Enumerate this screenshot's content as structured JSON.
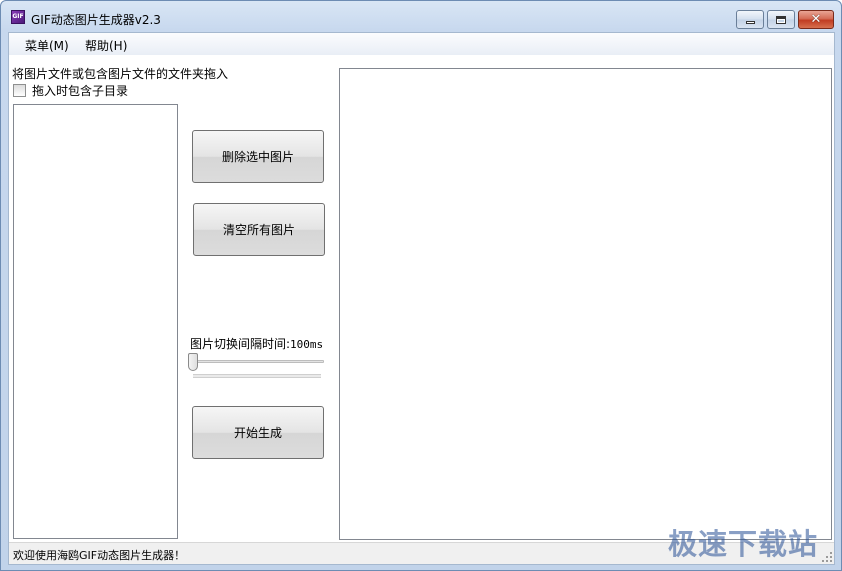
{
  "window": {
    "title": "GIF动态图片生成器v2.3",
    "icon_text": "GIF"
  },
  "menu": {
    "items": [
      {
        "label": "菜单(M)"
      },
      {
        "label": "帮助(H)"
      }
    ]
  },
  "main": {
    "instruction": "将图片文件或包含图片文件的文件夹拖入",
    "include_subdirs_label": "拖入时包含子目录",
    "include_subdirs_checked": false,
    "delete_selected_label": "删除选中图片",
    "clear_all_label": "清空所有图片",
    "interval_label": "图片切换间隔时间:",
    "interval_value": "100ms",
    "start_label": "开始生成"
  },
  "status": {
    "text": "欢迎使用海鸥GIF动态图片生成器！"
  },
  "watermark": {
    "text": "极速下载站"
  },
  "colors": {
    "title_gradient_top": "#d9e6f5",
    "close_button": "#c13c22",
    "watermark": "#2850a0"
  }
}
